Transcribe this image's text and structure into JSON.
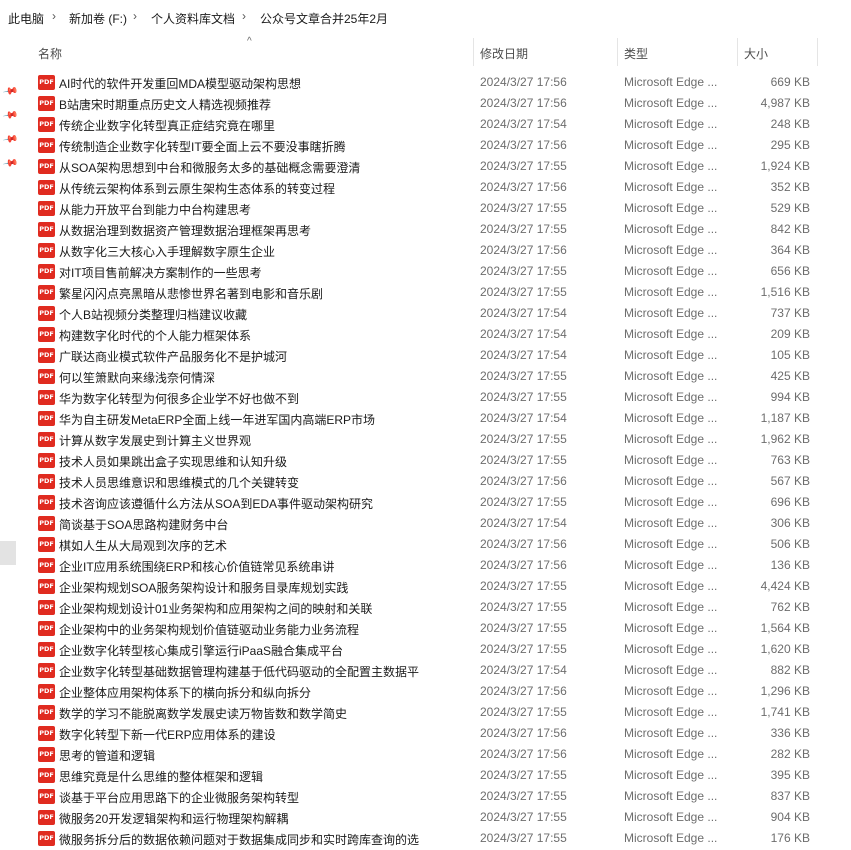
{
  "breadcrumb": [
    "此电脑",
    "新加卷 (F:)",
    "个人资料库文档",
    "公众号文章合并25年2月"
  ],
  "breadcrumb_separator": "›",
  "columns": {
    "name": "名称",
    "date": "修改日期",
    "type": "类型",
    "size": "大小"
  },
  "file_icon_label": "PDF",
  "files": [
    {
      "name": "AI时代的软件开发重回MDA模型驱动架构思想",
      "date": "2024/3/27 17:56",
      "type": "Microsoft Edge ...",
      "size": "669 KB"
    },
    {
      "name": "B站唐宋时期重点历史文人精选视频推荐",
      "date": "2024/3/27 17:56",
      "type": "Microsoft Edge ...",
      "size": "4,987 KB"
    },
    {
      "name": "传统企业数字化转型真正症结究竟在哪里",
      "date": "2024/3/27 17:54",
      "type": "Microsoft Edge ...",
      "size": "248 KB"
    },
    {
      "name": "传统制造企业数字化转型IT要全面上云不要没事瞎折腾",
      "date": "2024/3/27 17:56",
      "type": "Microsoft Edge ...",
      "size": "295 KB"
    },
    {
      "name": "从SOA架构思想到中台和微服务太多的基础概念需要澄清",
      "date": "2024/3/27 17:55",
      "type": "Microsoft Edge ...",
      "size": "1,924 KB"
    },
    {
      "name": "从传统云架构体系到云原生架构生态体系的转变过程",
      "date": "2024/3/27 17:56",
      "type": "Microsoft Edge ...",
      "size": "352 KB"
    },
    {
      "name": "从能力开放平台到能力中台构建思考",
      "date": "2024/3/27 17:55",
      "type": "Microsoft Edge ...",
      "size": "529 KB"
    },
    {
      "name": "从数据治理到数据资产管理数据治理框架再思考",
      "date": "2024/3/27 17:55",
      "type": "Microsoft Edge ...",
      "size": "842 KB"
    },
    {
      "name": "从数字化三大核心入手理解数字原生企业",
      "date": "2024/3/27 17:56",
      "type": "Microsoft Edge ...",
      "size": "364 KB"
    },
    {
      "name": "对IT项目售前解决方案制作的一些思考",
      "date": "2024/3/27 17:55",
      "type": "Microsoft Edge ...",
      "size": "656 KB"
    },
    {
      "name": "繁星闪闪点亮黑暗从悲惨世界名著到电影和音乐剧",
      "date": "2024/3/27 17:55",
      "type": "Microsoft Edge ...",
      "size": "1,516 KB"
    },
    {
      "name": "个人B站视频分类整理归档建议收藏",
      "date": "2024/3/27 17:54",
      "type": "Microsoft Edge ...",
      "size": "737 KB"
    },
    {
      "name": "构建数字化时代的个人能力框架体系",
      "date": "2024/3/27 17:54",
      "type": "Microsoft Edge ...",
      "size": "209 KB"
    },
    {
      "name": "广联达商业模式软件产品服务化不是护城河",
      "date": "2024/3/27 17:54",
      "type": "Microsoft Edge ...",
      "size": "105 KB"
    },
    {
      "name": "何以笙箫默向来缘浅奈何情深",
      "date": "2024/3/27 17:55",
      "type": "Microsoft Edge ...",
      "size": "425 KB"
    },
    {
      "name": "华为数字化转型为何很多企业学不好也做不到",
      "date": "2024/3/27 17:55",
      "type": "Microsoft Edge ...",
      "size": "994 KB"
    },
    {
      "name": "华为自主研发MetaERP全面上线一年进军国内高端ERP市场",
      "date": "2024/3/27 17:54",
      "type": "Microsoft Edge ...",
      "size": "1,187 KB"
    },
    {
      "name": "计算从数字发展史到计算主义世界观",
      "date": "2024/3/27 17:55",
      "type": "Microsoft Edge ...",
      "size": "1,962 KB"
    },
    {
      "name": "技术人员如果跳出盒子实现思维和认知升级",
      "date": "2024/3/27 17:55",
      "type": "Microsoft Edge ...",
      "size": "763 KB"
    },
    {
      "name": "技术人员思维意识和思维模式的几个关键转变",
      "date": "2024/3/27 17:56",
      "type": "Microsoft Edge ...",
      "size": "567 KB"
    },
    {
      "name": "技术咨询应该遵循什么方法从SOA到EDA事件驱动架构研究",
      "date": "2024/3/27 17:55",
      "type": "Microsoft Edge ...",
      "size": "696 KB"
    },
    {
      "name": "简谈基于SOA思路构建财务中台",
      "date": "2024/3/27 17:54",
      "type": "Microsoft Edge ...",
      "size": "306 KB"
    },
    {
      "name": "棋如人生从大局观到次序的艺术",
      "date": "2024/3/27 17:56",
      "type": "Microsoft Edge ...",
      "size": "506 KB"
    },
    {
      "name": "企业IT应用系统围绕ERP和核心价值链常见系统串讲",
      "date": "2024/3/27 17:56",
      "type": "Microsoft Edge ...",
      "size": "136 KB"
    },
    {
      "name": "企业架构规划SOA服务架构设计和服务目录库规划实践",
      "date": "2024/3/27 17:55",
      "type": "Microsoft Edge ...",
      "size": "4,424 KB"
    },
    {
      "name": "企业架构规划设计01业务架构和应用架构之间的映射和关联",
      "date": "2024/3/27 17:55",
      "type": "Microsoft Edge ...",
      "size": "762 KB"
    },
    {
      "name": "企业架构中的业务架构规划价值链驱动业务能力业务流程",
      "date": "2024/3/27 17:55",
      "type": "Microsoft Edge ...",
      "size": "1,564 KB"
    },
    {
      "name": "企业数字化转型核心集成引擎运行iPaaS融合集成平台",
      "date": "2024/3/27 17:55",
      "type": "Microsoft Edge ...",
      "size": "1,620 KB"
    },
    {
      "name": "企业数字化转型基础数据管理构建基于低代码驱动的全配置主数据平",
      "date": "2024/3/27 17:54",
      "type": "Microsoft Edge ...",
      "size": "882 KB"
    },
    {
      "name": "企业整体应用架构体系下的横向拆分和纵向拆分",
      "date": "2024/3/27 17:56",
      "type": "Microsoft Edge ...",
      "size": "1,296 KB"
    },
    {
      "name": "数学的学习不能脱离数学发展史读万物皆数和数学简史",
      "date": "2024/3/27 17:55",
      "type": "Microsoft Edge ...",
      "size": "1,741 KB"
    },
    {
      "name": "数字化转型下新一代ERP应用体系的建设",
      "date": "2024/3/27 17:56",
      "type": "Microsoft Edge ...",
      "size": "336 KB"
    },
    {
      "name": "思考的管道和逻辑",
      "date": "2024/3/27 17:56",
      "type": "Microsoft Edge ...",
      "size": "282 KB"
    },
    {
      "name": "思维究竟是什么思维的整体框架和逻辑",
      "date": "2024/3/27 17:55",
      "type": "Microsoft Edge ...",
      "size": "395 KB"
    },
    {
      "name": "谈基于平台应用思路下的企业微服务架构转型",
      "date": "2024/3/27 17:55",
      "type": "Microsoft Edge ...",
      "size": "837 KB"
    },
    {
      "name": "微服务20开发逻辑架构和运行物理架构解耦",
      "date": "2024/3/27 17:55",
      "type": "Microsoft Edge ...",
      "size": "904 KB"
    },
    {
      "name": "微服务拆分后的数据依赖问题对于数据集成同步和实时跨库查询的选",
      "date": "2024/3/27 17:55",
      "type": "Microsoft Edge ...",
      "size": "176 KB"
    }
  ]
}
